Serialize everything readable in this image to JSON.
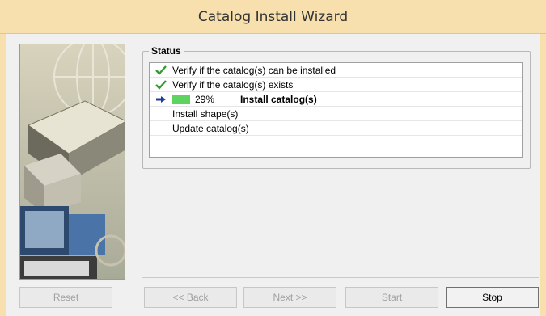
{
  "window": {
    "title": "Catalog Install Wizard"
  },
  "status": {
    "legend": "Status",
    "steps": [
      {
        "icon": "check-icon",
        "text": "Verify if the catalog(s) can be installed"
      },
      {
        "icon": "check-icon",
        "text": "Verify if the catalog(s) exists"
      },
      {
        "icon": "arrow-right-icon",
        "progress_text": "29%",
        "progress_value": 29,
        "text": "Install catalog(s)"
      },
      {
        "icon": "",
        "text": "Install shape(s)"
      },
      {
        "icon": "",
        "text": "Update catalog(s)"
      }
    ]
  },
  "buttons": {
    "reset": "Reset",
    "back": "<< Back",
    "next": "Next >>",
    "start": "Start",
    "stop": "Stop"
  },
  "colors": {
    "titlebar": "#f8dfae",
    "progress_fill": "#5fd35f",
    "check": "#2f9e2f",
    "arrow": "#1f3c9c"
  }
}
